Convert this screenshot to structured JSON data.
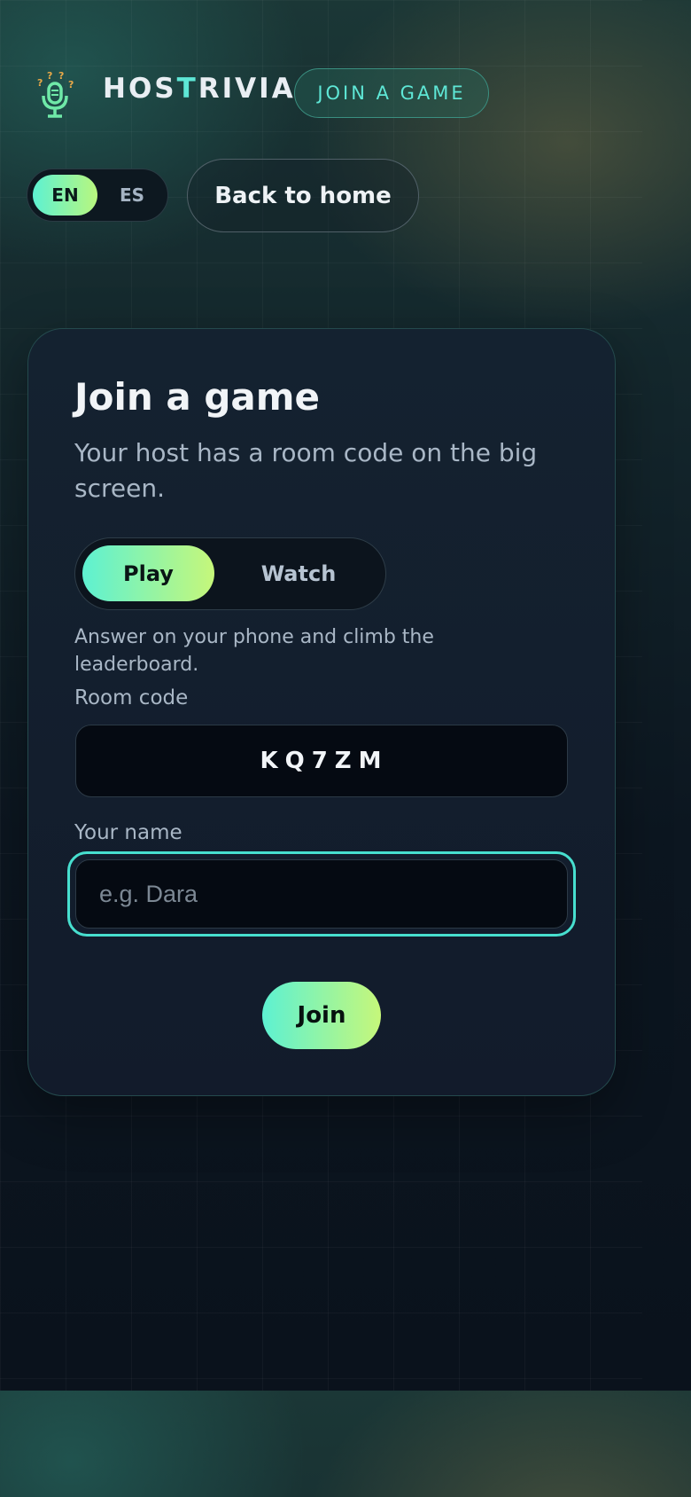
{
  "header": {
    "brand_prefix": "HOS",
    "brand_accent": "T",
    "brand_suffix": "RIVIA",
    "join_link": "JOIN A GAME",
    "logo_icon": "microphone-question-icon"
  },
  "language": {
    "options": [
      "EN",
      "ES"
    ],
    "selected": "EN"
  },
  "back_button": "Back to home",
  "card": {
    "title": "Join a game",
    "subtitle": "Your host has a room code on the big screen.",
    "mode": {
      "options": [
        "Play",
        "Watch"
      ],
      "selected": "Play",
      "description": "Answer on your phone and climb the leaderboard."
    },
    "room_code": {
      "label": "Room code",
      "value": "KQ7ZM"
    },
    "name": {
      "label": "Your name",
      "placeholder": "e.g. Dara",
      "value": ""
    },
    "submit": "Join"
  },
  "colors": {
    "accent": "#5ee7d6",
    "gradient_start": "#5df1d2",
    "gradient_end": "#c6f77a",
    "card_bg": "#131e2d",
    "page_bg": "#0a121c"
  }
}
